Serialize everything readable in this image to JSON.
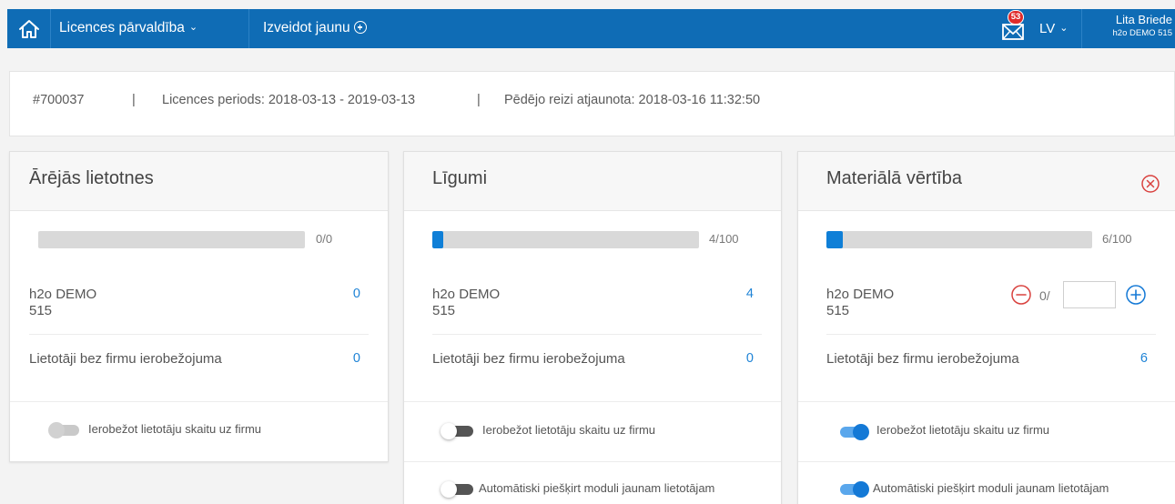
{
  "topbar": {
    "licence_menu": "Licences pārvaldība",
    "create_new": "Izveidot jaunu",
    "mail_badge": "53",
    "language": "LV",
    "user_name": "Lita Briede",
    "user_company": "h2o DEMO 515"
  },
  "info": {
    "id": "#700037",
    "separator": "|",
    "period": "Licences periods: 2018-03-13 - 2019-03-13",
    "updated": "Pēdējo reizi atjaunota: 2018-03-16 11:32:50"
  },
  "cards": [
    {
      "title": "Ārējās lietotnes",
      "usage": "0/0",
      "usage_fraction": 0,
      "company_line1": "h2o DEMO",
      "company_line2": "515",
      "company_value": "0",
      "unrestricted_label": "Lietotāji bez firmu ierobežojuma",
      "unrestricted_value": "0",
      "toggle_limit_label": "Ierobežot lietotāju skaitu uz firmu",
      "toggle_limit_on": false
    },
    {
      "title": "Līgumi",
      "usage": "4/100",
      "usage_fraction": 0.04,
      "company_line1": "h2o DEMO",
      "company_line2": "515",
      "company_value": "4",
      "unrestricted_label": "Lietotāji bez firmu ierobežojuma",
      "unrestricted_value": "0",
      "toggle_limit_label": "Ierobežot lietotāju skaitu uz firmu",
      "toggle_limit_on": false,
      "toggle_auto_label": "Automātiski piešķirt moduli jaunam lietotājam",
      "toggle_auto_on": false
    },
    {
      "title": "Materiālā vērtība",
      "usage": "6/100",
      "usage_fraction": 0.06,
      "company_line1": "h2o DEMO",
      "company_line2": "515",
      "stepper_prefix": "0/",
      "stepper_value": "",
      "unrestricted_label": "Lietotāji bez firmu ierobežojuma",
      "unrestricted_value": "6",
      "toggle_limit_label": "Ierobežot lietotāju skaitu uz firmu",
      "toggle_limit_on": true,
      "toggle_auto_label": "Automātiski piešķirt moduli jaunam lietotājam",
      "toggle_auto_on": true
    }
  ],
  "colors": {
    "brand": "#0f6cb5",
    "accent": "#0f7fd7",
    "danger": "#d9423f"
  }
}
